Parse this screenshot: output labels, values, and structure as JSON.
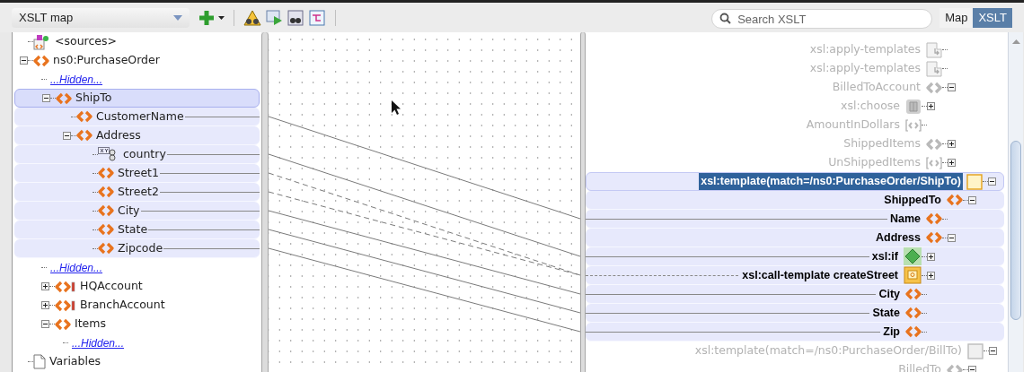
{
  "toolbar": {
    "map_selector": "XSLT map",
    "search": {
      "placeholder": "Search XSLT"
    },
    "view_tabs": [
      {
        "label": "Map",
        "selected": false
      },
      {
        "label": "XSLT",
        "selected": true
      }
    ]
  },
  "source_tree": [
    {
      "label": "<sources>",
      "kind": "sources",
      "selected": false,
      "highlighted": false
    },
    {
      "label": "ns0:PurchaseOrder",
      "kind": "element",
      "expanded": true,
      "selected": false,
      "highlighted": false,
      "children": [
        {
          "label": "...Hidden...",
          "kind": "link",
          "selected": false,
          "highlighted": false
        },
        {
          "label": "ShipTo",
          "kind": "element",
          "expanded": true,
          "selected": true,
          "highlighted": true,
          "children": [
            {
              "label": "CustomerName",
              "kind": "element",
              "selected": false,
              "highlighted": true,
              "mapped": true,
              "dashed": false
            },
            {
              "label": "Address",
              "kind": "element",
              "expanded": true,
              "selected": false,
              "highlighted": true,
              "children": [
                {
                  "label": "country",
                  "kind": "attribute",
                  "selected": false,
                  "highlighted": true,
                  "mapped": true,
                  "dashed": false
                },
                {
                  "label": "Street1",
                  "kind": "element",
                  "selected": false,
                  "highlighted": true,
                  "mapped": true,
                  "dashed": true
                },
                {
                  "label": "Street2",
                  "kind": "element",
                  "selected": false,
                  "highlighted": true,
                  "mapped": true,
                  "dashed": true
                },
                {
                  "label": "City",
                  "kind": "element",
                  "selected": false,
                  "highlighted": true,
                  "mapped": true,
                  "dashed": false
                },
                {
                  "label": "State",
                  "kind": "element",
                  "selected": false,
                  "highlighted": true,
                  "mapped": true,
                  "dashed": false
                },
                {
                  "label": "Zipcode",
                  "kind": "element",
                  "selected": false,
                  "highlighted": true,
                  "mapped": true,
                  "dashed": false
                }
              ]
            }
          ]
        },
        {
          "label": "...Hidden...",
          "kind": "link",
          "selected": false,
          "highlighted": false
        },
        {
          "label": "HQAccount",
          "kind": "element-required",
          "expanded": false,
          "selected": false,
          "highlighted": false
        },
        {
          "label": "BranchAccount",
          "kind": "element-required",
          "expanded": false,
          "selected": false,
          "highlighted": false
        },
        {
          "label": "Items",
          "kind": "element",
          "expanded": true,
          "selected": false,
          "highlighted": false,
          "children": [
            {
              "label": "...Hidden...",
              "kind": "link",
              "selected": false,
              "highlighted": false
            }
          ]
        }
      ]
    },
    {
      "label": "Variables",
      "kind": "document",
      "selected": false,
      "highlighted": false
    }
  ],
  "target_tree": {
    "upper_nodes": [
      {
        "label": "xsl:apply-templates",
        "kind": "apply-templates",
        "dimmed": true,
        "selected": false,
        "highlighted": false
      },
      {
        "label": "xsl:apply-templates",
        "kind": "apply-templates",
        "dimmed": true,
        "selected": false,
        "highlighted": false
      },
      {
        "label": "BilledToAccount",
        "kind": "element",
        "expanded": true,
        "dimmed": true,
        "selected": false,
        "highlighted": false,
        "children": [
          {
            "label": "xsl:choose",
            "kind": "choose",
            "expanded": false,
            "dimmed": true,
            "selected": false,
            "highlighted": false
          },
          {
            "label": "AmountInDollars",
            "kind": "element-bracket",
            "dimmed": true,
            "selected": false,
            "highlighted": false
          }
        ]
      },
      {
        "label": "ShippedItems",
        "kind": "element",
        "expanded": false,
        "dimmed": true,
        "selected": false,
        "highlighted": false
      },
      {
        "label": "UnShippedItems",
        "kind": "element-bracket",
        "expanded": false,
        "dimmed": true,
        "selected": false,
        "highlighted": false
      }
    ],
    "nodes": [
      {
        "label": "xsl:template(match=/ns0:PurchaseOrder/ShipTo)",
        "kind": "template",
        "expanded": true,
        "dimmed": false,
        "selected": true,
        "highlighted": true,
        "children": [
          {
            "label": "ShippedTo",
            "kind": "element",
            "expanded": true,
            "dimmed": false,
            "selected": false,
            "highlighted": true,
            "children": [
              {
                "label": "Name",
                "kind": "element",
                "dimmed": false,
                "selected": false,
                "highlighted": true,
                "mapped": true,
                "dashed": false
              },
              {
                "label": "Address",
                "kind": "element",
                "expanded": true,
                "dimmed": false,
                "selected": false,
                "highlighted": true,
                "children": [
                  {
                    "label": "xsl:if",
                    "kind": "if",
                    "expanded": false,
                    "dimmed": false,
                    "selected": false,
                    "highlighted": true,
                    "mapped": true,
                    "dashed": false
                  },
                  {
                    "label": "xsl:call-template createStreet",
                    "kind": "call-template",
                    "expanded": false,
                    "dimmed": false,
                    "selected": false,
                    "highlighted": true,
                    "mapped": true,
                    "dashed": true
                  },
                  {
                    "label": "City",
                    "kind": "element",
                    "dimmed": false,
                    "selected": false,
                    "highlighted": true,
                    "mapped": true,
                    "dashed": false
                  },
                  {
                    "label": "State",
                    "kind": "element",
                    "dimmed": false,
                    "selected": false,
                    "highlighted": true,
                    "mapped": true,
                    "dashed": false
                  },
                  {
                    "label": "Zip",
                    "kind": "element",
                    "dimmed": false,
                    "selected": false,
                    "highlighted": true,
                    "mapped": true,
                    "dashed": false
                  }
                ]
              }
            ]
          }
        ]
      },
      {
        "label": "xsl:template(match=/ns0:PurchaseOrder/BillTo)",
        "kind": "template",
        "expanded": true,
        "dimmed": true,
        "selected": false,
        "highlighted": false,
        "children": [
          {
            "label": "BilledTo",
            "kind": "element",
            "expanded": true,
            "dimmed": true,
            "selected": false,
            "highlighted": false
          }
        ]
      }
    ]
  }
}
